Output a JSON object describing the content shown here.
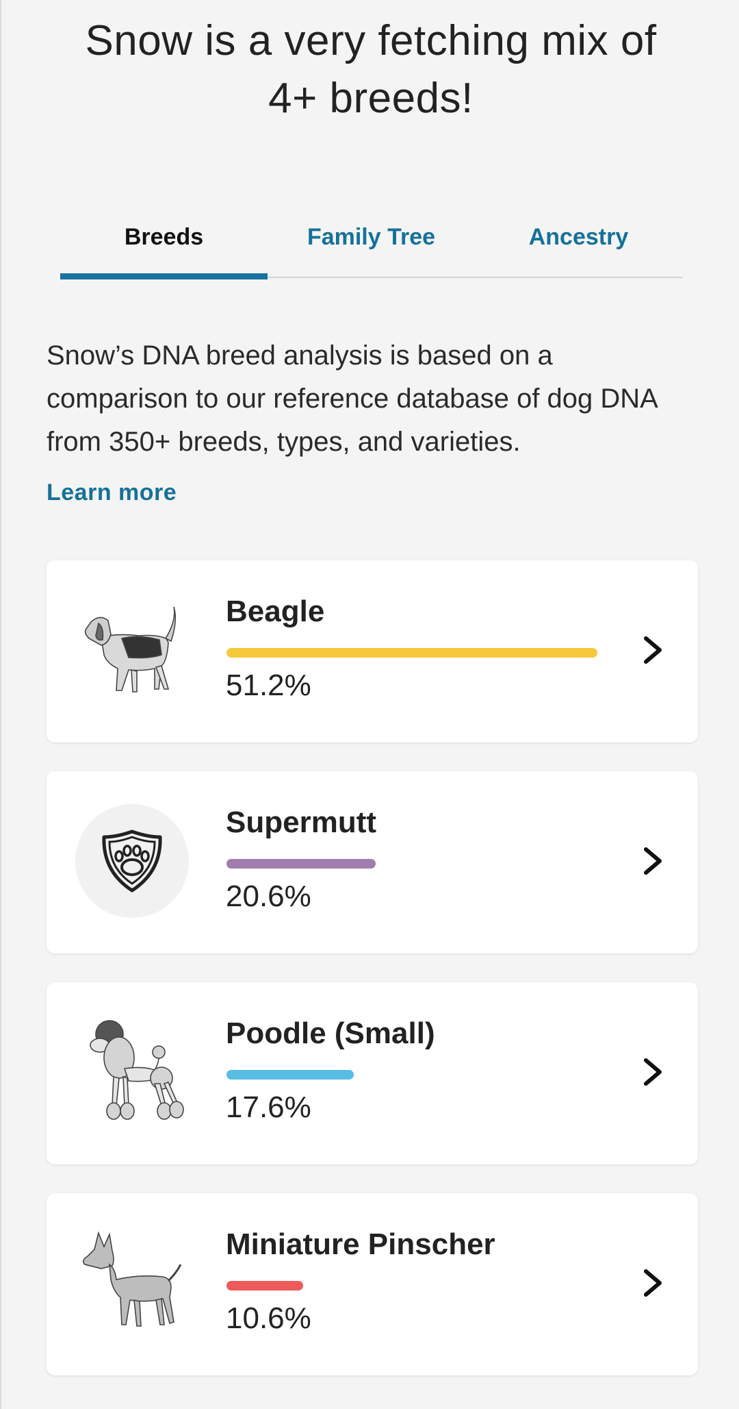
{
  "headline": "Snow is a very fetching mix of 4+ breeds!",
  "tabs": [
    {
      "label": "Breeds",
      "active": true
    },
    {
      "label": "Family Tree",
      "active": false
    },
    {
      "label": "Ancestry",
      "active": false
    }
  ],
  "intro": "Snow’s DNA breed analysis is based on a comparison to our reference database of dog DNA from 350+ breeds, types, and varieties.",
  "learn_more": "Learn more",
  "breeds": [
    {
      "name": "Beagle",
      "percent_label": "51.2%",
      "percent": 51.2,
      "bar_color": "#f6c93b",
      "icon": "beagle-illustration"
    },
    {
      "name": "Supermutt",
      "percent_label": "20.6%",
      "percent": 20.6,
      "bar_color": "#a27cae",
      "icon": "paw-shield-icon"
    },
    {
      "name": "Poodle (Small)",
      "percent_label": "17.6%",
      "percent": 17.6,
      "bar_color": "#57bde3",
      "icon": "poodle-illustration"
    },
    {
      "name": "Miniature Pinscher",
      "percent_label": "10.6%",
      "percent": 10.6,
      "bar_color": "#ee5b5b",
      "icon": "miniature-pinscher-illustration"
    }
  ],
  "colors": {
    "accent": "#15719a",
    "tab_underline": "#1672a0",
    "background": "#f4f4f4",
    "card": "#ffffff"
  }
}
